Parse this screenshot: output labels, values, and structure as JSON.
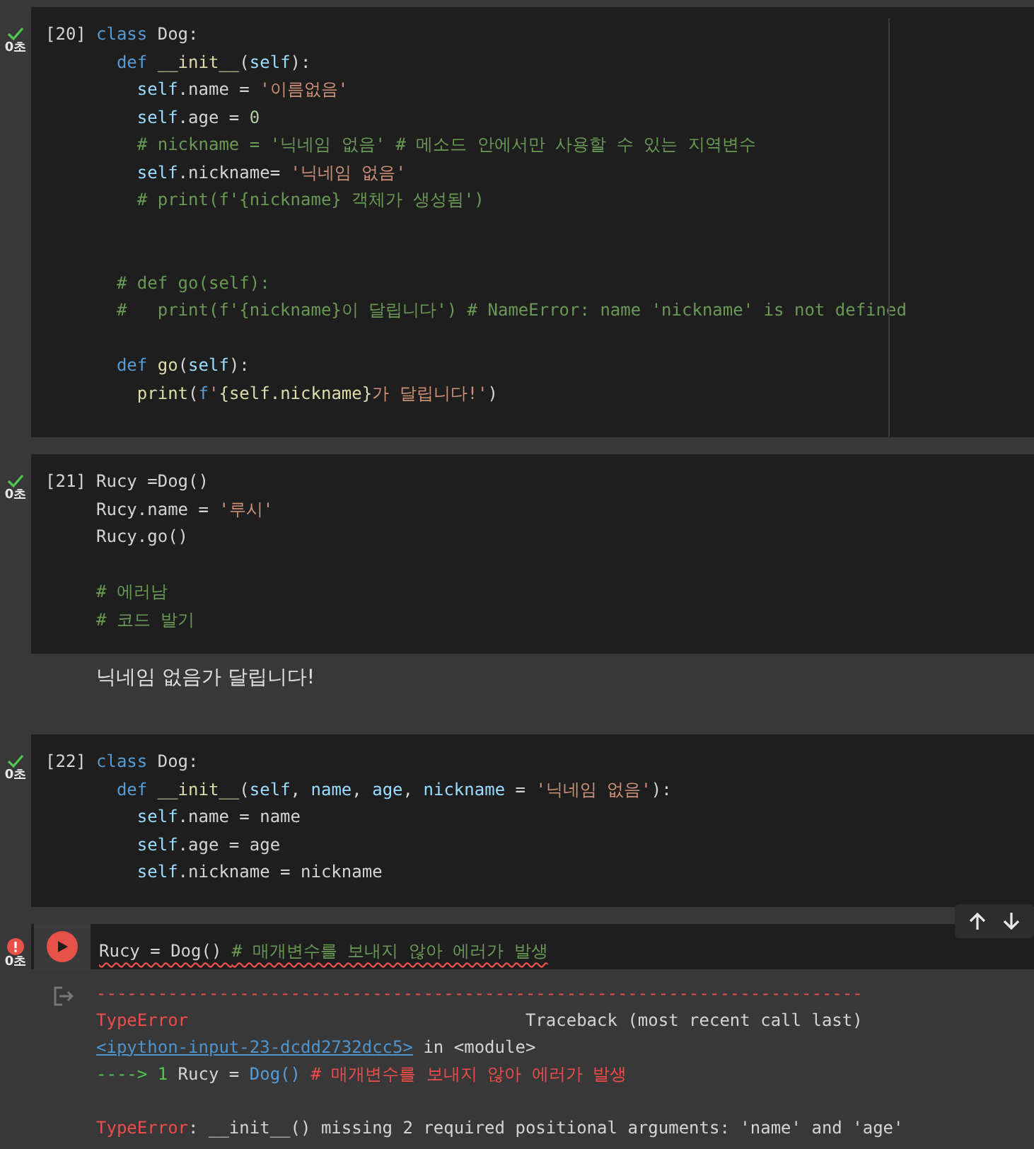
{
  "cells": [
    {
      "kind": "code",
      "prompt": "[20]",
      "failed": false,
      "time": "0초",
      "focused": false,
      "ruler": true,
      "lines": [
        {
          "kind": "code",
          "tokens": [
            {
              "kind": "kw",
              "text": "class"
            },
            {
              "kind": "p",
              "text": " Dog:"
            }
          ]
        },
        {
          "kind": "code",
          "tokens": [
            {
              "kind": "kw",
              "text": "  def "
            },
            {
              "kind": "fn",
              "text": "__init__"
            },
            {
              "kind": "p",
              "text": "("
            },
            {
              "kind": "var",
              "text": "self"
            },
            {
              "kind": "p",
              "text": "):"
            }
          ]
        },
        {
          "kind": "code",
          "tokens": [
            {
              "kind": "var",
              "text": "    self"
            },
            {
              "kind": "p",
              "text": ".name = "
            },
            {
              "kind": "str",
              "text": "'이름없음'"
            }
          ]
        },
        {
          "kind": "code",
          "tokens": [
            {
              "kind": "var",
              "text": "    self"
            },
            {
              "kind": "p",
              "text": ".age = "
            },
            {
              "kind": "num",
              "text": "0"
            }
          ]
        },
        {
          "kind": "code",
          "tokens": [
            {
              "kind": "com",
              "text": "    # nickname = '닉네임 없음' # 메소드 안에서만 사용할 수 있는 지역변수"
            }
          ]
        },
        {
          "kind": "code",
          "tokens": [
            {
              "kind": "var",
              "text": "    self"
            },
            {
              "kind": "p",
              "text": ".nickname= "
            },
            {
              "kind": "str",
              "text": "'닉네임 없음'"
            }
          ]
        },
        {
          "kind": "code",
          "tokens": [
            {
              "kind": "com",
              "text": "    # print(f'{nickname} 객체가 생성됨')"
            }
          ]
        },
        {
          "kind": "blank"
        },
        {
          "kind": "blank"
        },
        {
          "kind": "code",
          "tokens": [
            {
              "kind": "com",
              "text": "  # def go(self):"
            }
          ]
        },
        {
          "kind": "code",
          "tokens": [
            {
              "kind": "com",
              "text": "  #   print(f'{nickname}이 달립니다') # NameError: name 'nickname' is not defined"
            }
          ]
        },
        {
          "kind": "blank"
        },
        {
          "kind": "code",
          "tokens": [
            {
              "kind": "kw",
              "text": "  def "
            },
            {
              "kind": "fn",
              "text": "go"
            },
            {
              "kind": "p",
              "text": "("
            },
            {
              "kind": "var",
              "text": "self"
            },
            {
              "kind": "p",
              "text": "):"
            }
          ]
        },
        {
          "kind": "code",
          "tokens": [
            {
              "kind": "fn",
              "text": "    print"
            },
            {
              "kind": "p",
              "text": "("
            },
            {
              "kind": "kw",
              "text": "f"
            },
            {
              "kind": "str",
              "text": "'"
            },
            {
              "kind": "fn",
              "text": "{self.nickname}"
            },
            {
              "kind": "str",
              "text": "가 달립니다!'"
            },
            {
              "kind": "p",
              "text": ")"
            }
          ]
        }
      ]
    },
    {
      "kind": "code",
      "prompt": "[21]",
      "failed": false,
      "time": "0초",
      "focused": false,
      "ruler": false,
      "lines": [
        {
          "kind": "code",
          "tokens": [
            {
              "kind": "p",
              "text": "Rucy =Dog()"
            }
          ]
        },
        {
          "kind": "code",
          "tokens": [
            {
              "kind": "p",
              "text": "Rucy.name = "
            },
            {
              "kind": "str",
              "text": "'루시'"
            }
          ]
        },
        {
          "kind": "code",
          "tokens": [
            {
              "kind": "p",
              "text": "Rucy.go()"
            }
          ]
        },
        {
          "kind": "blank"
        },
        {
          "kind": "code",
          "tokens": [
            {
              "kind": "com",
              "text": "# 에러남"
            }
          ]
        },
        {
          "kind": "code",
          "tokens": [
            {
              "kind": "com",
              "text": "# 코드 발기"
            }
          ]
        }
      ],
      "output": {
        "kind": "text",
        "text": "닉네임 없음가 달립니다!"
      }
    },
    {
      "kind": "code",
      "prompt": "[22]",
      "failed": false,
      "time": "0초",
      "focused": false,
      "ruler": false,
      "lines": [
        {
          "kind": "code",
          "tokens": [
            {
              "kind": "kw",
              "text": "class"
            },
            {
              "kind": "p",
              "text": " Dog:"
            }
          ]
        },
        {
          "kind": "code",
          "tokens": [
            {
              "kind": "kw",
              "text": "  def "
            },
            {
              "kind": "fn",
              "text": "__init__"
            },
            {
              "kind": "p",
              "text": "("
            },
            {
              "kind": "var",
              "text": "self"
            },
            {
              "kind": "p",
              "text": ", "
            },
            {
              "kind": "var",
              "text": "name"
            },
            {
              "kind": "p",
              "text": ", "
            },
            {
              "kind": "var",
              "text": "age"
            },
            {
              "kind": "p",
              "text": ", "
            },
            {
              "kind": "var",
              "text": "nickname"
            },
            {
              "kind": "p",
              "text": " = "
            },
            {
              "kind": "str",
              "text": "'닉네임 없음'"
            },
            {
              "kind": "p",
              "text": "):"
            }
          ]
        },
        {
          "kind": "code",
          "tokens": [
            {
              "kind": "var",
              "text": "    self"
            },
            {
              "kind": "p",
              "text": ".name = name"
            }
          ]
        },
        {
          "kind": "code",
          "tokens": [
            {
              "kind": "var",
              "text": "    self"
            },
            {
              "kind": "p",
              "text": ".age = age"
            }
          ]
        },
        {
          "kind": "code",
          "tokens": [
            {
              "kind": "var",
              "text": "    self"
            },
            {
              "kind": "p",
              "text": ".nickname = nickname"
            }
          ]
        }
      ]
    },
    {
      "kind": "code",
      "failed": true,
      "time": "0초",
      "focused": true,
      "ruler": false,
      "lines": [
        {
          "kind": "code",
          "squiggle": true,
          "tokens": [
            {
              "kind": "p",
              "text": "Rucy = Dog() "
            },
            {
              "kind": "com",
              "text": "# 매개변수를 보내지 않아 에러가 발생"
            }
          ]
        }
      ],
      "output": {
        "kind": "error",
        "lines": [
          {
            "kind": "code",
            "tokens": [
              {
                "kind": "err",
                "text": "---------------------------------------------------------------------------"
              }
            ]
          },
          {
            "kind": "code",
            "tokens": [
              {
                "kind": "err",
                "text": "TypeError"
              },
              {
                "kind": "p",
                "text": "                                 Traceback (most recent call last)"
              }
            ]
          },
          {
            "kind": "code",
            "tokens": [
              {
                "kind": "link",
                "text": "<ipython-input-23-dcdd2732dcc5>"
              },
              {
                "kind": "p",
                "text": " in <module>"
              }
            ]
          },
          {
            "kind": "code",
            "tokens": [
              {
                "kind": "arrow",
                "text": "----> 1 "
              },
              {
                "kind": "p",
                "text": "Rucy = "
              },
              {
                "kind": "cls",
                "text": "Dog()"
              },
              {
                "kind": "err",
                "text": " # 매개변수를 보내지 않아 에러가 발생"
              }
            ]
          },
          {
            "kind": "blank"
          },
          {
            "kind": "code",
            "tokens": [
              {
                "kind": "err",
                "text": "TypeError"
              },
              {
                "kind": "p",
                "text": ": __init__() missing 2 required positional arguments: 'name' and 'age'"
              }
            ]
          }
        ]
      }
    }
  ]
}
